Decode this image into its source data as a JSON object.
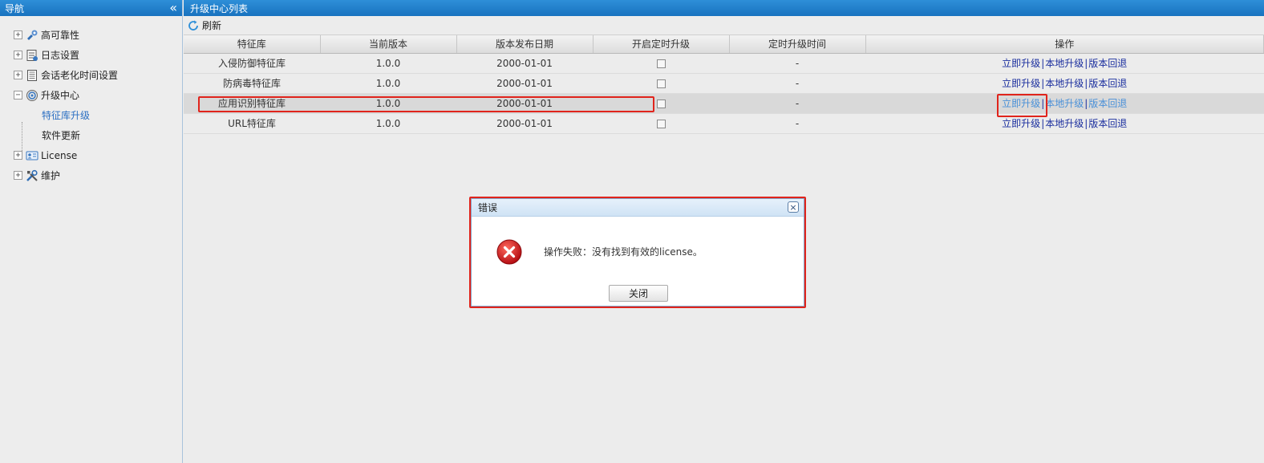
{
  "sidebar": {
    "title": "导航",
    "collapse_glyph": "«",
    "items": [
      {
        "label": "高可靠性",
        "icon": "reliability-icon",
        "expander": "+"
      },
      {
        "label": "日志设置",
        "icon": "log-settings-icon",
        "expander": "+"
      },
      {
        "label": "会话老化时间设置",
        "icon": "session-aging-icon",
        "expander": "+"
      },
      {
        "label": "升级中心",
        "icon": "upgrade-center-icon",
        "expander": "−",
        "children": [
          {
            "label": "特征库升级",
            "active": true
          },
          {
            "label": "软件更新",
            "active": false
          }
        ]
      },
      {
        "label": "License",
        "icon": "license-icon",
        "expander": "+"
      },
      {
        "label": "维护",
        "icon": "maintenance-icon",
        "expander": "+"
      }
    ]
  },
  "main": {
    "title": "升级中心列表",
    "toolbar": {
      "refresh_label": "刷新"
    },
    "columns": [
      "特征库",
      "当前版本",
      "版本发布日期",
      "开启定时升级",
      "定时升级时间",
      "操作"
    ],
    "rows": [
      {
        "name": "入侵防御特征库",
        "version": "1.0.0",
        "date": "2000-01-01",
        "scheduled": false,
        "time": "-"
      },
      {
        "name": "防病毒特征库",
        "version": "1.0.0",
        "date": "2000-01-01",
        "scheduled": false,
        "time": "-"
      },
      {
        "name": "应用识别特征库",
        "version": "1.0.0",
        "date": "2000-01-01",
        "scheduled": false,
        "time": "-",
        "selected": true
      },
      {
        "name": "URL特征库",
        "version": "1.0.0",
        "date": "2000-01-01",
        "scheduled": false,
        "time": "-"
      }
    ],
    "actions": {
      "upgrade_now": "立即升级",
      "local_upgrade": "本地升级",
      "rollback": "版本回退",
      "separator": "|"
    }
  },
  "dialog": {
    "title": "错误",
    "message": "操作失败：没有找到有效的license。",
    "close_button": "关闭",
    "close_glyph": "×"
  },
  "colors": {
    "header_blue": "#1872bf",
    "link_blue": "#1a2e9e",
    "highlight_red": "#e0241c",
    "error_red": "#d0101a"
  }
}
